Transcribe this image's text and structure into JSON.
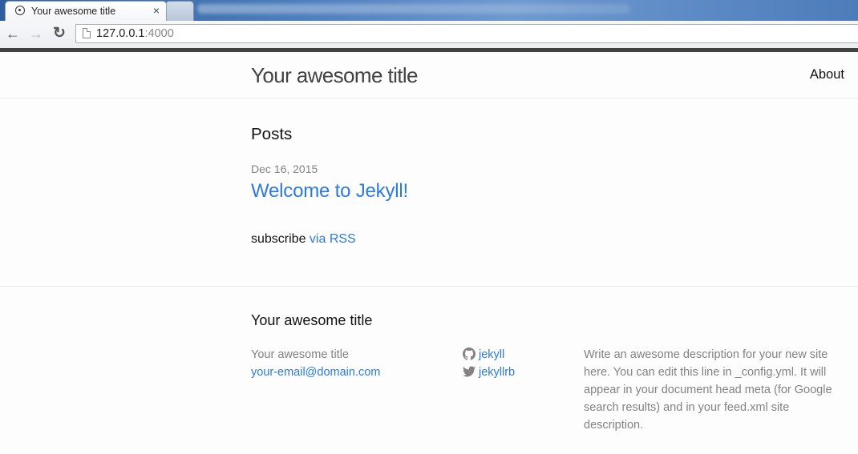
{
  "browser": {
    "active_tab": {
      "title": "Your awesome title",
      "close_glyph": "×"
    },
    "address": {
      "host": "127.0.0.1",
      "port": ":4000"
    },
    "icons": {
      "favicon": "globe-icon",
      "back": "back-arrow-icon",
      "forward": "forward-arrow-icon",
      "reload": "reload-icon",
      "page": "page-icon"
    }
  },
  "header": {
    "site_title": "Your awesome title",
    "nav": [
      {
        "label": "About"
      }
    ]
  },
  "main": {
    "heading": "Posts",
    "posts": [
      {
        "date": "Dec 16, 2015",
        "title": "Welcome to Jekyll!"
      }
    ],
    "rss": {
      "prefix": "subscribe ",
      "link": "via RSS"
    }
  },
  "footer": {
    "heading": "Your awesome title",
    "name": "Your awesome title",
    "email": "your-email@domain.com",
    "social": [
      {
        "icon": "github-icon",
        "username": "jekyll"
      },
      {
        "icon": "twitter-icon",
        "username": "jekyllrb"
      }
    ],
    "description": "Write an awesome description for your new site here. You can edit this line in _config.yml. It will appear in your document head meta (for Google search results) and in your feed.xml site description."
  },
  "colors": {
    "link": "#2a7ae2",
    "text": "#111111",
    "muted": "#828282",
    "title": "#424242",
    "chrome_rule": "#424242"
  }
}
